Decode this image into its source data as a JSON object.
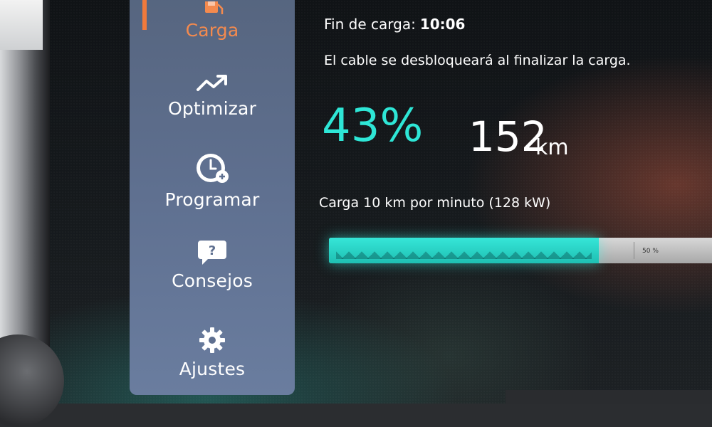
{
  "sidebar": {
    "items": [
      {
        "label": "Carga",
        "icon": "fuel-pump-icon",
        "active": true
      },
      {
        "label": "Optimizar",
        "icon": "trend-up-icon",
        "active": false
      },
      {
        "label": "Programar",
        "icon": "clock-plug-icon",
        "active": false
      },
      {
        "label": "Consejos",
        "icon": "question-bubble-icon",
        "active": false
      },
      {
        "label": "Ajustes",
        "icon": "gear-icon",
        "active": false
      }
    ]
  },
  "charge": {
    "eta_label": "Fin de carga:",
    "eta_value": "10:06",
    "cable_message": "El cable se desbloqueará al finalizar la carga.",
    "percent_text": "43%",
    "percent_value": 43,
    "range_value": "152",
    "range_unit": "km",
    "rate_text": "Carga 10 km por minuto (128 kW)",
    "bar_mark": "50 %",
    "bar_mark_value": 50
  },
  "colors": {
    "accent": "#2ee6d6",
    "active_nav": "#f48a4e",
    "sidebar": "#5f7090"
  }
}
